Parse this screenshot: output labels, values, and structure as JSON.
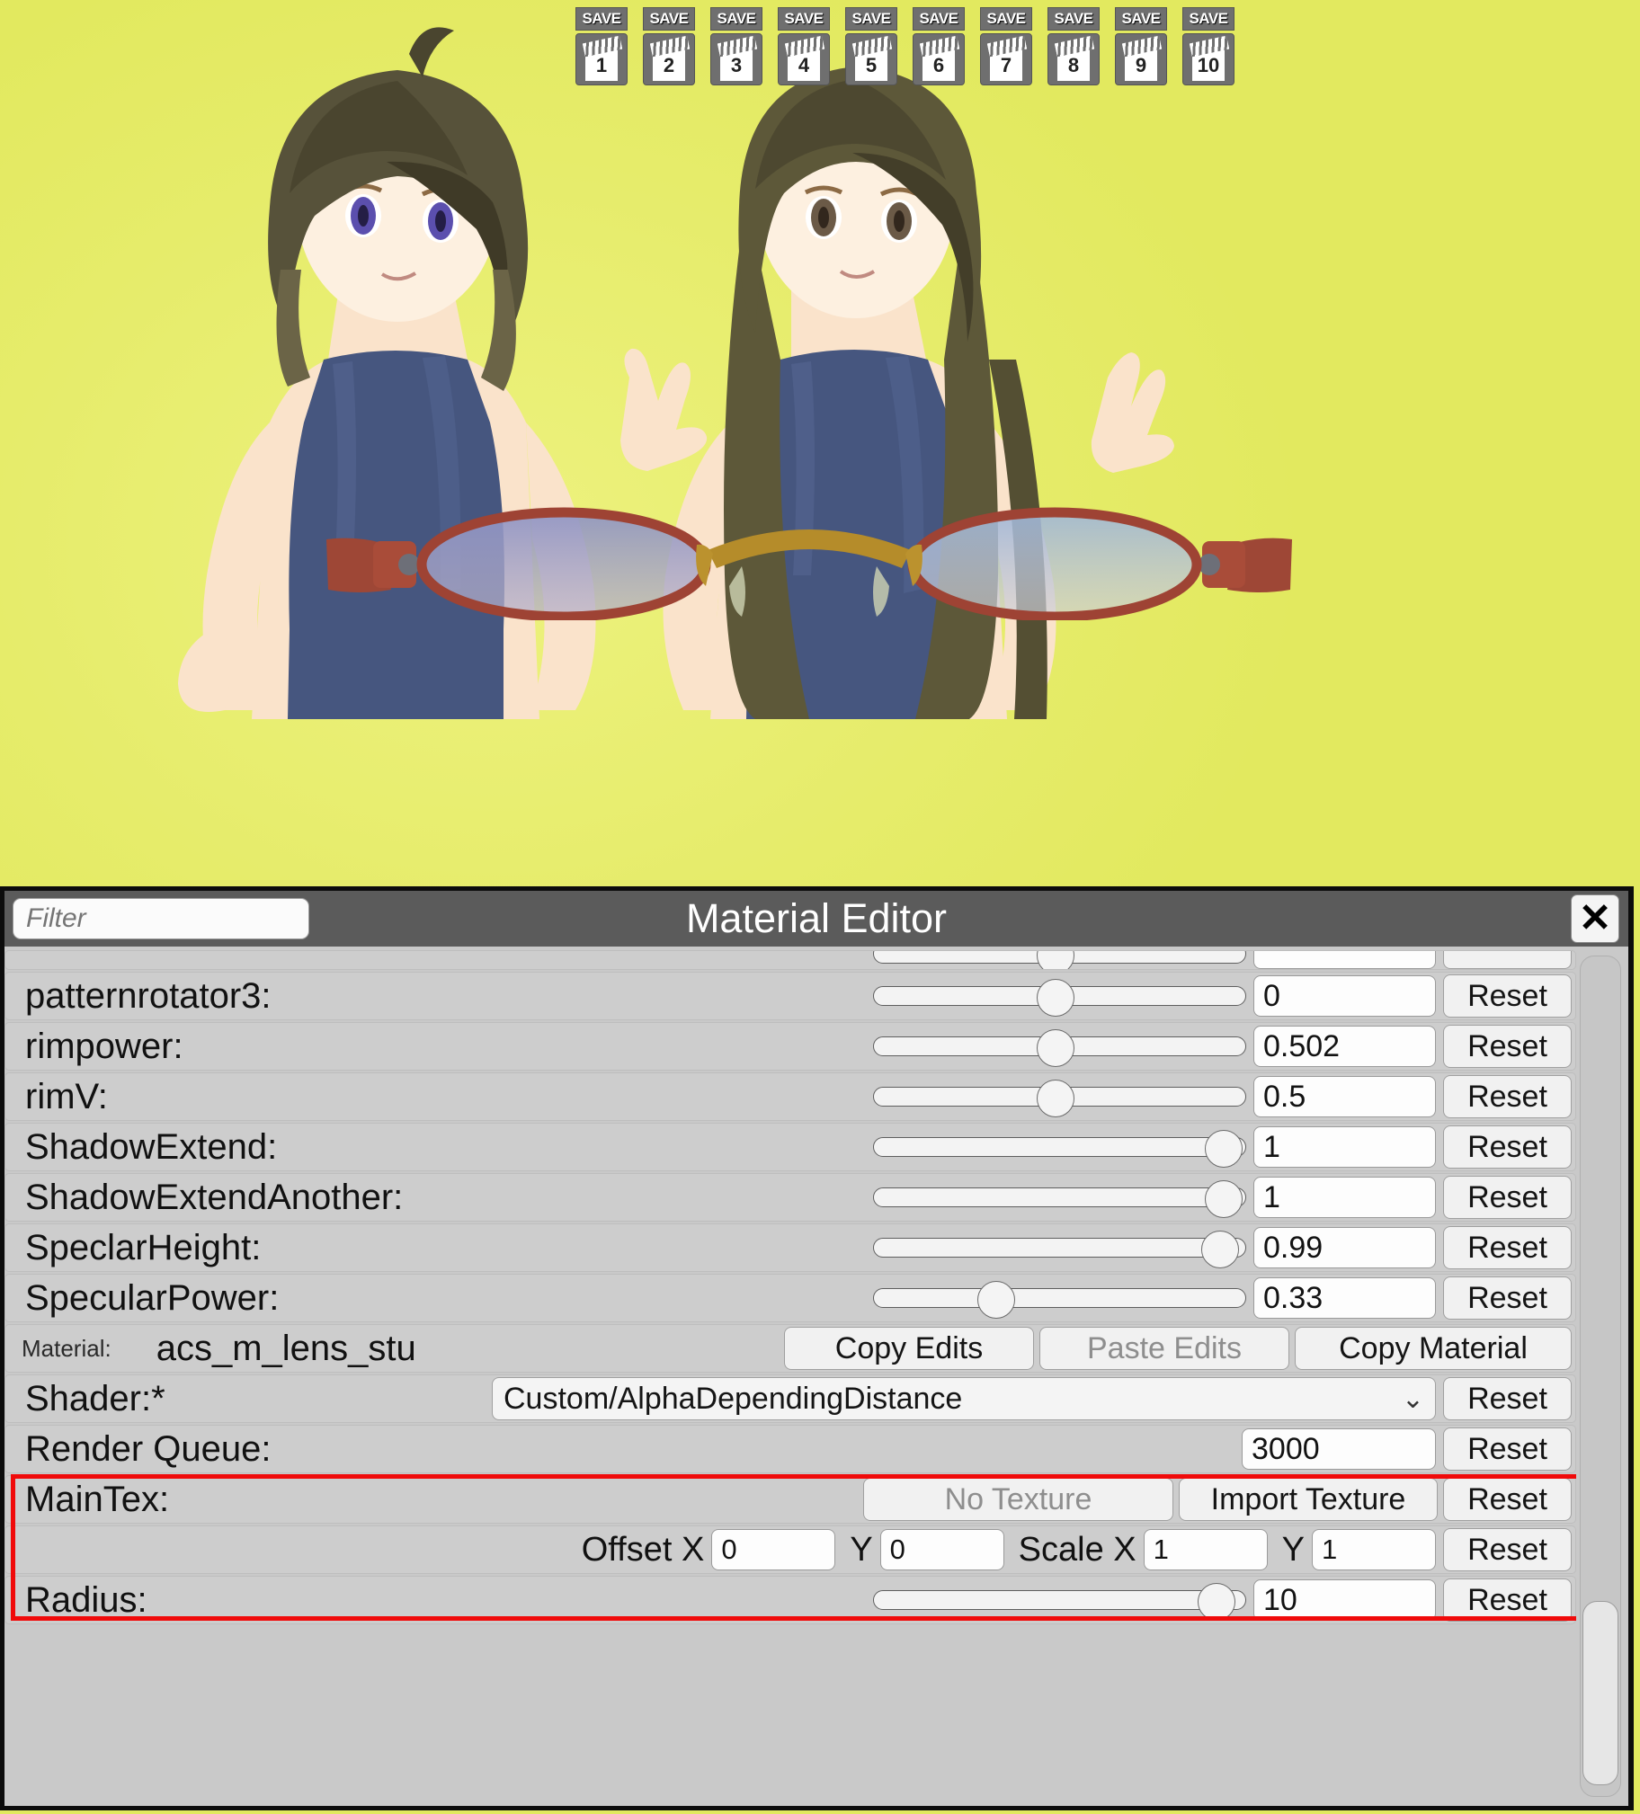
{
  "save_strip": {
    "label": "SAVE",
    "slots": [
      "1",
      "2",
      "3",
      "4",
      "5",
      "6",
      "7",
      "8",
      "9",
      "10"
    ]
  },
  "window": {
    "title": "Material Editor",
    "close_label": "✕",
    "filter_placeholder": "Filter"
  },
  "rows": [
    {
      "label": "patternrotator3:",
      "type": "slider",
      "value": "0",
      "knob_pct": 49,
      "reset": "Reset"
    },
    {
      "label": "rimpower:",
      "type": "slider",
      "value": "0.502",
      "knob_pct": 49,
      "reset": "Reset"
    },
    {
      "label": "rimV:",
      "type": "slider",
      "value": "0.5",
      "knob_pct": 49,
      "reset": "Reset"
    },
    {
      "label": "ShadowExtend:",
      "type": "slider",
      "value": "1",
      "knob_pct": 94,
      "reset": "Reset"
    },
    {
      "label": "ShadowExtendAnother:",
      "type": "slider",
      "value": "1",
      "knob_pct": 94,
      "reset": "Reset"
    },
    {
      "label": "SpeclarHeight:",
      "type": "slider",
      "value": "0.99",
      "knob_pct": 93,
      "reset": "Reset"
    },
    {
      "label": "SpecularPower:",
      "type": "slider",
      "value": "0.33",
      "knob_pct": 33,
      "reset": "Reset"
    }
  ],
  "material_row": {
    "label": "Material:",
    "name": "acs_m_lens_stu",
    "copy_edits": "Copy Edits",
    "paste_edits": "Paste Edits",
    "paste_edits_disabled": true,
    "copy_material": "Copy Material"
  },
  "shader_row": {
    "label": "Shader:*",
    "value": "Custom/AlphaDependingDistance",
    "chevron": "⌄",
    "reset": "Reset"
  },
  "render_queue_row": {
    "label": "Render Queue:",
    "value": "3000",
    "reset": "Reset"
  },
  "maintex_row": {
    "label": "MainTex:",
    "no_texture": "No Texture",
    "no_texture_disabled": true,
    "import_texture": "Import Texture",
    "reset": "Reset"
  },
  "offset_row": {
    "offset_label": "Offset X",
    "offset_x": "0",
    "offset_y_label": "Y",
    "offset_y": "0",
    "scale_label": "Scale X",
    "scale_x": "1",
    "scale_y_label": "Y",
    "scale_y": "1",
    "reset": "Reset"
  },
  "radius_row": {
    "label": "Radius:",
    "value": "10",
    "knob_pct": 92,
    "reset": "Reset"
  },
  "colors": {
    "highlight_red": "#f00a0a",
    "titlebar": "#5b5b5b",
    "panel": "#c9c9c9",
    "viewport_bg": "#e9ef72"
  }
}
